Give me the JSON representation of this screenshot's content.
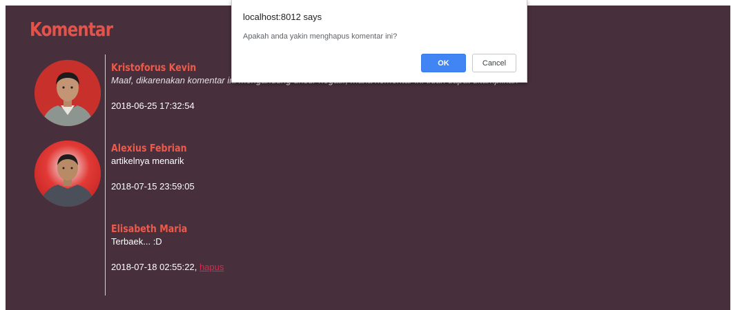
{
  "page": {
    "title": "Komentar"
  },
  "comments": [
    {
      "name": "Kristoforus Kevin",
      "text": "Maaf, dikarenakan komentar ini mengandung unsur negatif, maka komentar ini tidak dapat ditampilkan",
      "time": "2018-06-25 17:32:54"
    },
    {
      "name": "Alexius Febrian",
      "text": "artikelnya menarik",
      "time": "2018-07-15 23:59:05"
    },
    {
      "name": "Elisabeth Maria",
      "text": "Terbaek... :D",
      "time": "2018-07-18 02:55:22, ",
      "delete_label": "hapus"
    }
  ],
  "dialog": {
    "title": "localhost:8012 says",
    "message": "Apakah anda yakin menghapus komentar ini?",
    "ok_label": "OK",
    "cancel_label": "Cancel"
  },
  "colors": {
    "background": "#47303c",
    "accent": "#e4524a",
    "link": "#d7284e",
    "ok_button": "#4184f3"
  }
}
